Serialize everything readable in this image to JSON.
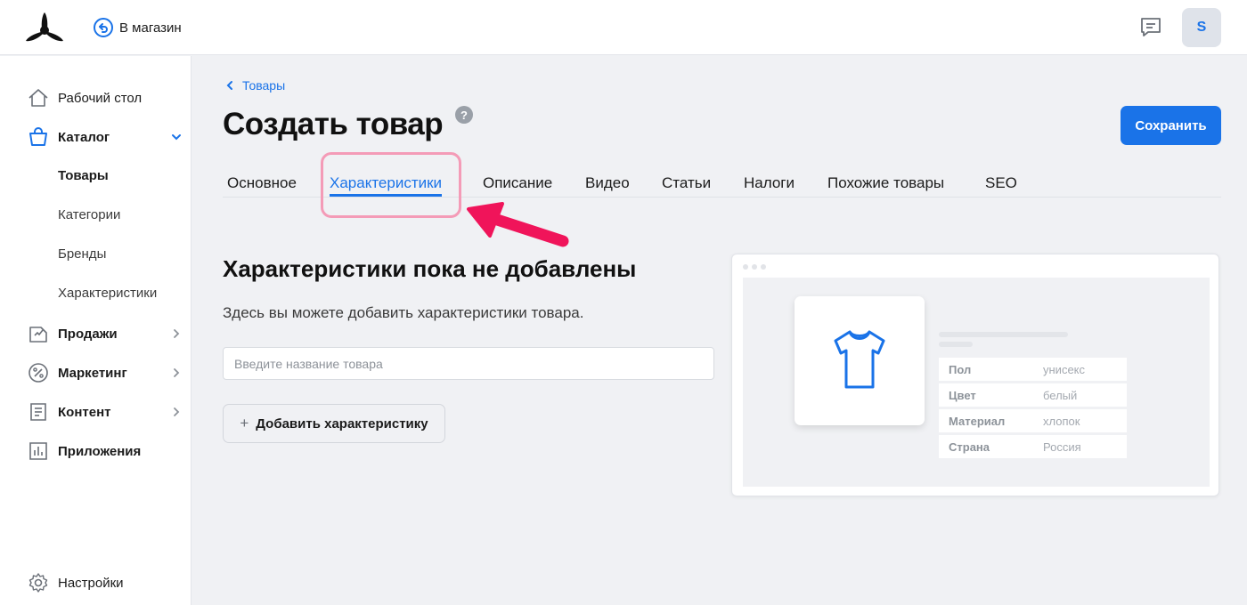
{
  "header": {
    "back_to_store": "В магазин",
    "avatar_initial": "S"
  },
  "sidebar": {
    "items": [
      {
        "label": "Рабочий стол"
      },
      {
        "label": "Каталог"
      },
      {
        "label": "Продажи"
      },
      {
        "label": "Маркетинг"
      },
      {
        "label": "Контент"
      },
      {
        "label": "Приложения"
      }
    ],
    "catalog_sub": [
      {
        "label": "Товары"
      },
      {
        "label": "Категории"
      },
      {
        "label": "Бренды"
      },
      {
        "label": "Характеристики"
      }
    ],
    "settings": "Настройки"
  },
  "main": {
    "breadcrumb": "Товары",
    "title": "Создать товар",
    "help": "?",
    "save_label": "Сохранить",
    "tabs": [
      {
        "label": "Основное"
      },
      {
        "label": "Характеристики"
      },
      {
        "label": "Описание"
      },
      {
        "label": "Видео"
      },
      {
        "label": "Статьи"
      },
      {
        "label": "Налоги"
      },
      {
        "label": "Похожие товары"
      },
      {
        "label": "SEO"
      }
    ],
    "active_tab": "Характеристики",
    "empty_title": "Характеристики пока не добавлены",
    "empty_desc": "Здесь вы можете добавить характеристики товара.",
    "input_placeholder": "Введите название товара",
    "add_label": "Добавить характеристику",
    "add_plus": "+"
  },
  "illustration": {
    "specs": [
      {
        "key": "Пол",
        "value": "унисекс"
      },
      {
        "key": "Цвет",
        "value": "белый"
      },
      {
        "key": "Материал",
        "value": "хлопок"
      },
      {
        "key": "Страна",
        "value": "Россия"
      }
    ]
  },
  "colors": {
    "accent": "#1a73e8",
    "highlight": "#f49bb7",
    "arrow": "#f0145a"
  }
}
